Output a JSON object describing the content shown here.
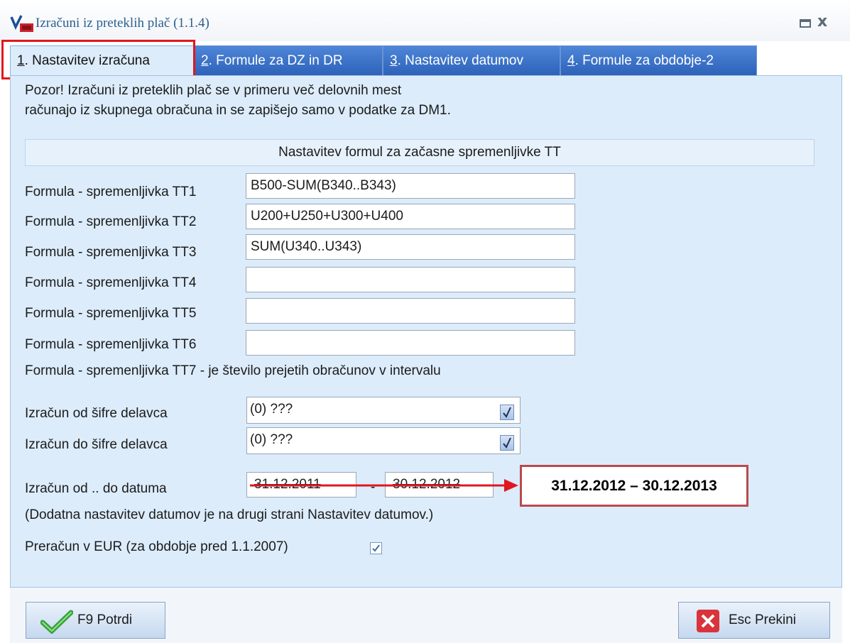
{
  "window": {
    "title": "Izračuni iz preteklih plač  (1.1.4)",
    "restore_icon": "restore-icon",
    "close_symbol": "x"
  },
  "tabs": [
    {
      "num": "1",
      "label": ". Nastavitev izračuna",
      "active": true
    },
    {
      "num": "2",
      "label": ". Formule za DZ in DR",
      "active": false
    },
    {
      "num": "3",
      "label": ". Nastavitev datumov",
      "active": false
    },
    {
      "num": "4",
      "label": ". Formule za obdobje-2",
      "active": false
    }
  ],
  "warning": {
    "line1": "Pozor! Izračuni iz preteklih plač se v primeru več delovnih mest",
    "line2": "računajo iz skupnega obračuna in se zapišejo samo v podatke za DM1."
  },
  "section_title": "Nastavitev formul za začasne spremenljivke TT",
  "formulas": [
    {
      "label": "Formula - spremenljivka TT1",
      "value": "B500-SUM(B340..B343)"
    },
    {
      "label": "Formula - spremenljivka TT2",
      "value": "U200+U250+U300+U400"
    },
    {
      "label": "Formula - spremenljivka TT3",
      "value": "SUM(U340..U343)"
    },
    {
      "label": "Formula - spremenljivka TT4",
      "value": ""
    },
    {
      "label": "Formula - spremenljivka TT5",
      "value": ""
    },
    {
      "label": "Formula - spremenljivka TT6",
      "value": ""
    }
  ],
  "tt7_note": "Formula - spremenljivka TT7 - je število prejetih obračunov v intervalu",
  "worker_from": {
    "label": "Izračun od šifre delavca",
    "value": "(0) ???"
  },
  "worker_to": {
    "label": "Izračun do šifre delavca",
    "value": "(0) ???"
  },
  "date_range": {
    "label": "Izračun od .. do datuma",
    "from": "31.12.2011",
    "separator": "-",
    "to": "30.12.2012"
  },
  "annotation": {
    "text": "31.12.2012 – 30.12.2013",
    "arrow_color": "#e0171f",
    "border_color": "#b94a4e"
  },
  "date_note": "(Dodatna nastavitev datumov je na drugi strani Nastavitev datumov.)",
  "eur_conversion": {
    "label": "Preračun v EUR (za obdobje pred 1.1.2007)",
    "checked": true
  },
  "buttons": {
    "confirm": "F9 Potrdi",
    "cancel": "Esc Prekini"
  },
  "colors": {
    "tab_blue": "#2d62b9",
    "panel": "#dcecfb",
    "highlight_red": "#e0171f"
  }
}
